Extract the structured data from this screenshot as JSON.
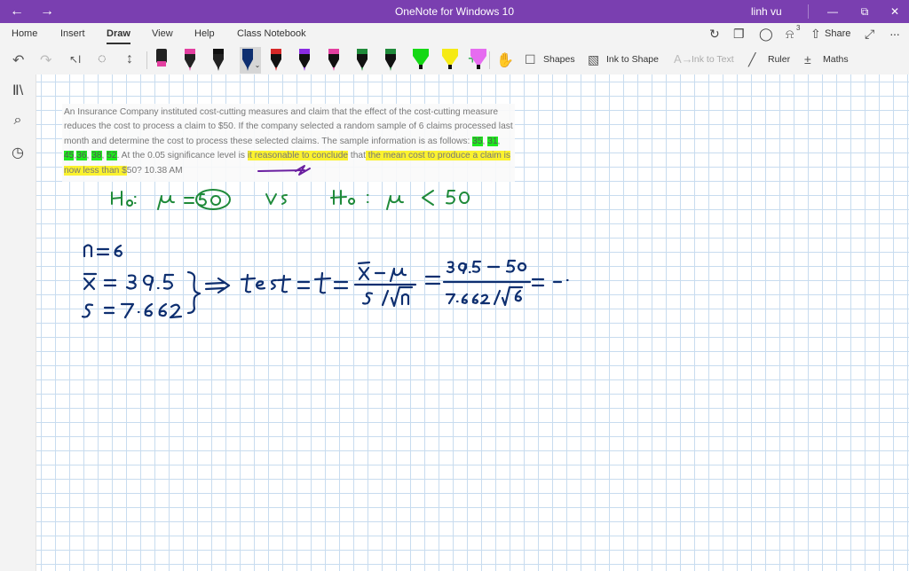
{
  "titlebar": {
    "back": "←",
    "forward": "→",
    "title": "OneNote for Windows 10",
    "user": "linh vu",
    "minimize": "—",
    "restore": "⧉",
    "close": "✕"
  },
  "menu": {
    "tabs": [
      "Home",
      "Insert",
      "Draw",
      "View",
      "Help",
      "Class Notebook"
    ],
    "active": "Draw",
    "share": "Share"
  },
  "ribbon": {
    "shapes": "Shapes",
    "ink_to_shape": "Ink to Shape",
    "ink_to_text": "Ink to Text",
    "ruler": "Ruler",
    "maths": "Maths"
  },
  "notification_count": "3",
  "colors": {
    "titlebar": "#7a3fb0",
    "ink_green": "#1f8a3a",
    "ink_blue": "#0e2f70",
    "ink_purple": "#6a1fa0",
    "highlight_green": "#1dea1d",
    "highlight_yellow": "#fbf22e"
  },
  "pens": [
    {
      "body": "#222222",
      "tip": "#e33fa0",
      "type": "pen"
    },
    {
      "body": "#222222",
      "tip": "#111111",
      "type": "pen"
    },
    {
      "body": "#0e2f70",
      "tip": "#0e2f70",
      "type": "pen",
      "selected": true
    },
    {
      "body": "#111111",
      "tip": "#d62828",
      "type": "pen"
    },
    {
      "body": "#111111",
      "tip": "#8a2be2",
      "type": "pen"
    },
    {
      "body": "#111111",
      "tip": "#e33fa0",
      "type": "pen"
    },
    {
      "body": "#111111",
      "tip": "#1f8a3a",
      "type": "pen"
    },
    {
      "body": "#111111",
      "tip": "#1f8a3a",
      "type": "pen"
    },
    {
      "body": "#15d815",
      "tip": "#111111",
      "type": "highlighter"
    },
    {
      "body": "#f5ea15",
      "tip": "#111111",
      "type": "highlighter"
    },
    {
      "body": "#e66cf0",
      "tip": "#111111",
      "type": "highlighter"
    }
  ],
  "question": {
    "part1": "An Insurance Company instituted cost-cutting measures and claim that the effect of the cost-cutting measure reduces the cost to process a claim to $50. If the company selected a random sample of 6 claims processed last month and determine the cost to process these selected claims. The sample information is as follows: ",
    "v1": "35",
    "c1": ", ",
    "v2": "31",
    "c2": ", ",
    "v3": "45",
    "c3": ",",
    "v4": "36",
    "c4": ", ",
    "v5": "38",
    "c5": ", ",
    "v6": "52",
    "part2": ". At the 0.05 significance level is ",
    "h1": "it reasonable to conclude",
    "part3": " that",
    "h2": " the mean cost to produce a claim is now less than $",
    "part4": "50? 10.38 AM"
  }
}
